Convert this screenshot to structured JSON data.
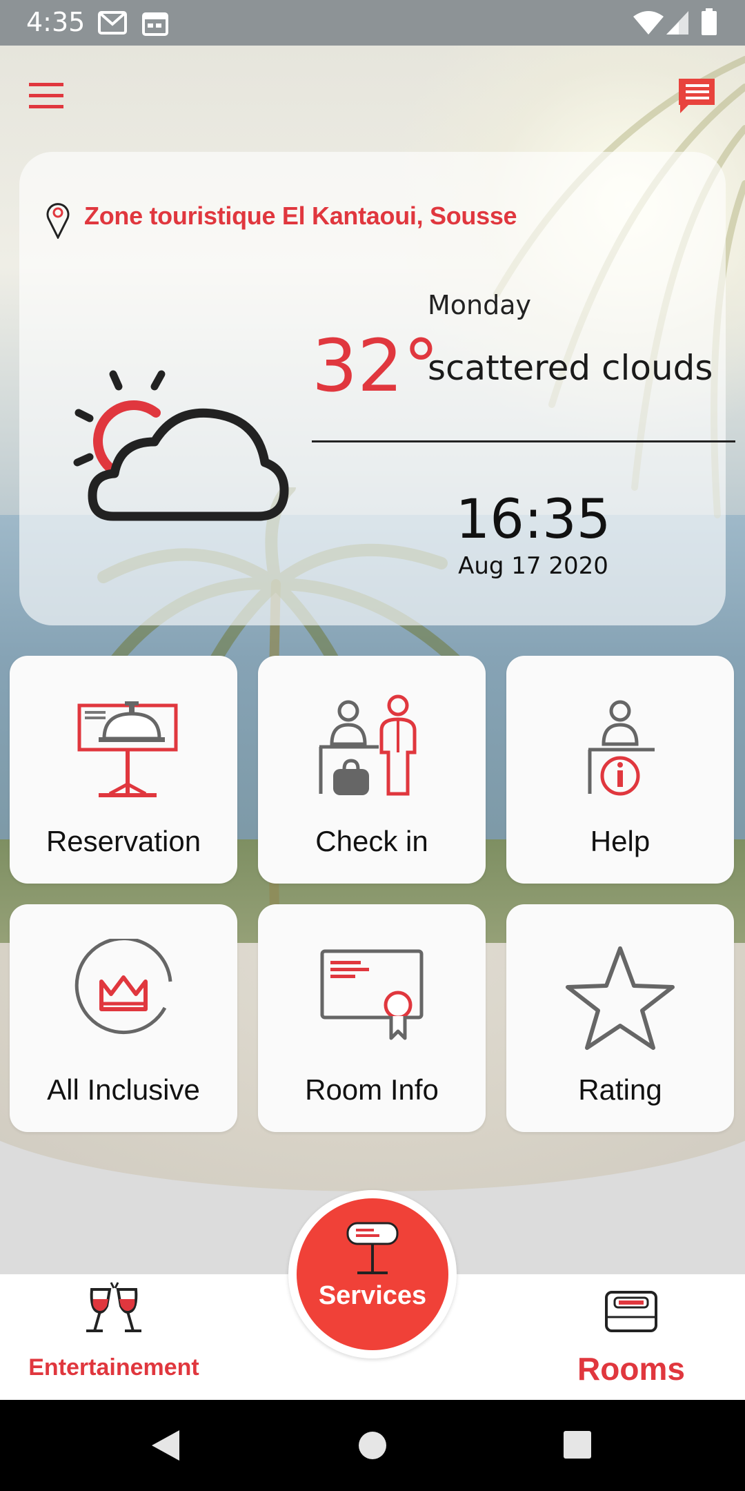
{
  "status_bar": {
    "time": "4:35",
    "icons": [
      "gmail-icon",
      "calendar-icon",
      "wifi-icon",
      "cellular-signal-icon",
      "battery-icon"
    ]
  },
  "header": {
    "menu_icon": "hamburger-menu-icon",
    "chat_icon": "chat-message-icon"
  },
  "weather": {
    "location": "Zone touristique El Kantaoui, Sousse",
    "day": "Monday",
    "temperature": "32°",
    "description": "scattered clouds",
    "time": "16:35",
    "date": "Aug 17 2020",
    "icon": "partly-cloudy-icon"
  },
  "tiles": [
    {
      "label": "Reservation",
      "icon": "reception-bell-icon"
    },
    {
      "label": "Check in",
      "icon": "check-in-desk-icon"
    },
    {
      "label": "Help",
      "icon": "help-info-desk-icon"
    },
    {
      "label": "All Inclusive",
      "icon": "crown-badge-icon"
    },
    {
      "label": "Room Info",
      "icon": "certificate-icon"
    },
    {
      "label": "Rating",
      "icon": "star-icon"
    }
  ],
  "bottom_nav": {
    "entertainment": "Entertainement",
    "services": "Services",
    "rooms": "Rooms"
  },
  "colors": {
    "accent": "#e0373e",
    "services_button": "#f04138",
    "status_bar": "#8d9396"
  }
}
